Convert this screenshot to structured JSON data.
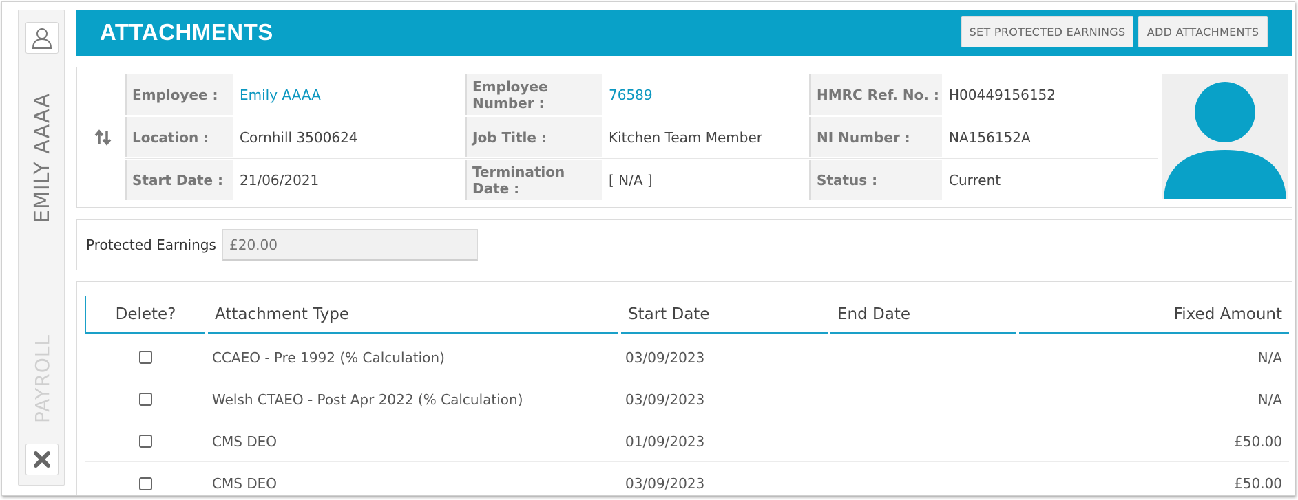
{
  "sidebar": {
    "employee_name": "EMILY AAAA",
    "module_name": "PAYROLL",
    "user_icon": "user-icon",
    "close_icon": "close-icon"
  },
  "header": {
    "title": "ATTACHMENTS",
    "set_protected_label": "SET PROTECTED EARNINGS",
    "add_attachments_label": "ADD ATTACHMENTS"
  },
  "employee": {
    "employee_label": "Employee :",
    "employee_value": "Emily AAAA",
    "location_label": "Location :",
    "location_value": "Cornhill 3500624",
    "start_date_label": "Start Date :",
    "start_date_value": "21/06/2021",
    "employee_number_label": "Employee Number :",
    "employee_number_value": "76589",
    "job_title_label": "Job Title :",
    "job_title_value": "Kitchen Team Member",
    "termination_label": "Termination Date :",
    "termination_value": "[ N/A ]",
    "hmrc_label": "HMRC Ref. No. :",
    "hmrc_value": "H00449156152",
    "ni_label": "NI Number :",
    "ni_value": "NA156152A",
    "status_label": "Status :",
    "status_value": "Current"
  },
  "protected": {
    "label": "Protected Earnings",
    "placeholder": "£20.00"
  },
  "table": {
    "headers": {
      "delete": "Delete?",
      "type": "Attachment Type",
      "start": "Start Date",
      "end": "End Date",
      "amount": "Fixed Amount"
    },
    "rows": [
      {
        "type": "CCAEO - Pre 1992 (% Calculation)",
        "start": "03/09/2023",
        "end": "",
        "amount": "N/A"
      },
      {
        "type": "Welsh CTAEO - Post Apr 2022 (% Calculation)",
        "start": "03/09/2023",
        "end": "",
        "amount": "N/A"
      },
      {
        "type": "CMS DEO",
        "start": "01/09/2023",
        "end": "",
        "amount": "£50.00"
      },
      {
        "type": "CMS DEO",
        "start": "03/09/2023",
        "end": "",
        "amount": "£50.00"
      }
    ]
  },
  "colors": {
    "accent": "#09a1c8",
    "link": "#0b97c0"
  }
}
